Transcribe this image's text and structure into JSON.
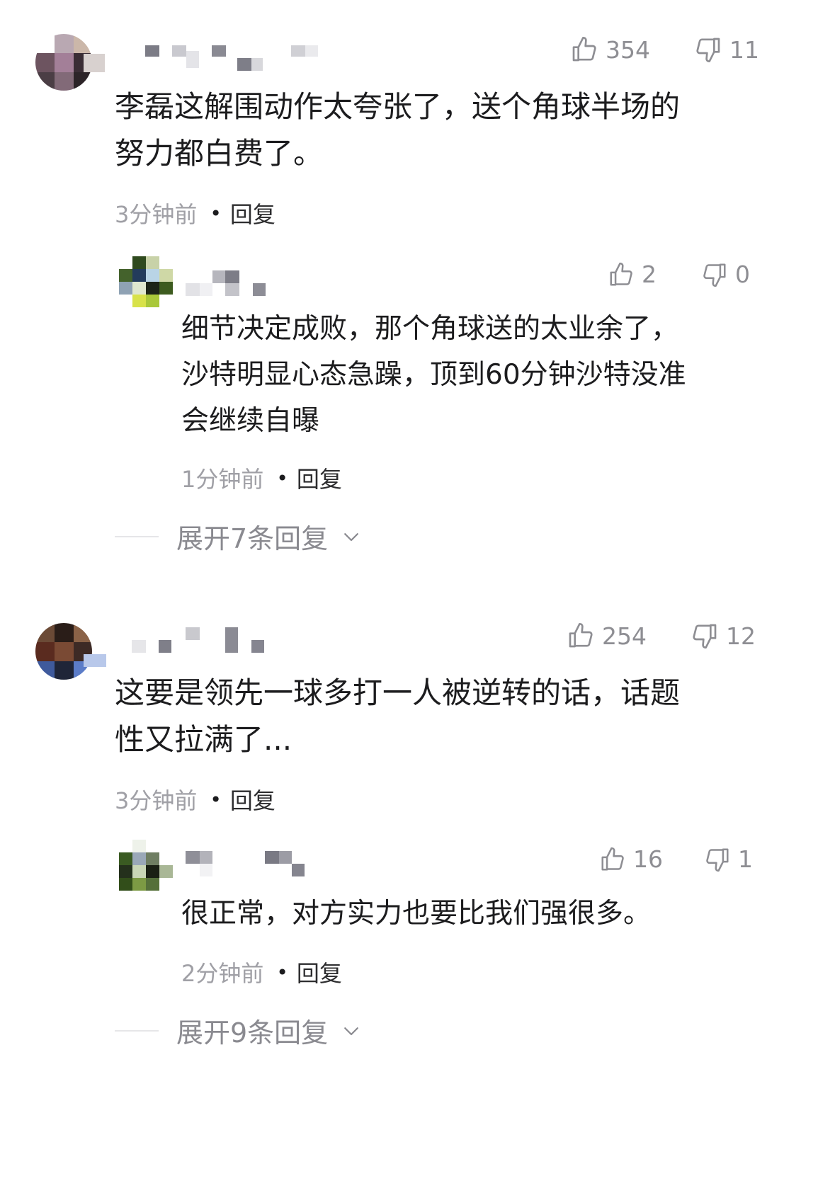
{
  "comments": [
    {
      "likes": "354",
      "dislikes": "11",
      "text_line1": "李磊这解围动作太夸张了，送个角球半场的",
      "text_line2": "努力都白费了。",
      "time": "3分钟前",
      "reply_label": "回复",
      "reply": {
        "likes": "2",
        "dislikes": "0",
        "text_line1": "细节决定成败，那个角球送的太业余了，",
        "text_line2": "沙特明显心态急躁，顶到60分钟沙特没准",
        "text_line3": "会继续自曝",
        "time": "1分钟前",
        "reply_label": "回复"
      },
      "expand_label": "展开7条回复"
    },
    {
      "likes": "254",
      "dislikes": "12",
      "text_line1": "这要是领先一球多打一人被逆转的话，话题",
      "text_line2": "性又拉满了...",
      "time": "3分钟前",
      "reply_label": "回复",
      "reply": {
        "likes": "16",
        "dislikes": "1",
        "text_line1": "很正常，对方实力也要比我们强很多。",
        "time": "2分钟前",
        "reply_label": "回复"
      },
      "expand_label": "展开9条回复"
    }
  ],
  "icons": {
    "like": "thumbs-up-icon",
    "dislike": "thumbs-down-icon",
    "expand": "chevron-down-icon"
  },
  "colors": {
    "text": "#1c1c1e",
    "muted": "#8e8e93",
    "background": "#ffffff"
  }
}
